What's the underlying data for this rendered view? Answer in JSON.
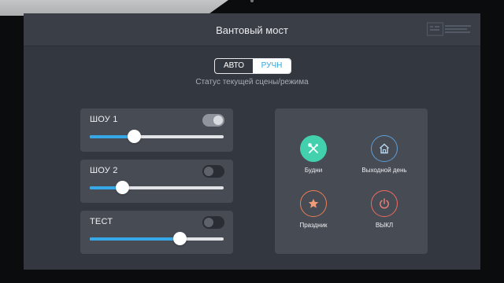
{
  "app": {
    "title": "Вантовый мост"
  },
  "mode": {
    "auto_label": "АВТО",
    "manual_label": "РУЧН",
    "active": "manual"
  },
  "status_text": "Статус текущей сцены/режима",
  "scenes": [
    {
      "name": "ШОУ 1",
      "enabled": true,
      "level": 0.33
    },
    {
      "name": "ШОУ 2",
      "enabled": false,
      "level": 0.24
    },
    {
      "name": "ТЕСТ",
      "enabled": false,
      "level": 0.67
    }
  ],
  "quick_actions": [
    {
      "label": "Будни",
      "icon": "tools-icon",
      "accent": "#43d1ad",
      "filled": true
    },
    {
      "label": "Выходной день",
      "icon": "home-icon",
      "accent": "#5f9edb",
      "filled": false
    },
    {
      "label": "Праздник",
      "icon": "star-icon",
      "accent": "#ec7d57",
      "filled": false
    },
    {
      "label": "ВЫКЛ",
      "icon": "power-icon",
      "accent": "#f06b63",
      "filled": false
    }
  ],
  "colors": {
    "background": "#33373f",
    "panel": "#474b53",
    "accent_blue": "#36a8e8"
  }
}
